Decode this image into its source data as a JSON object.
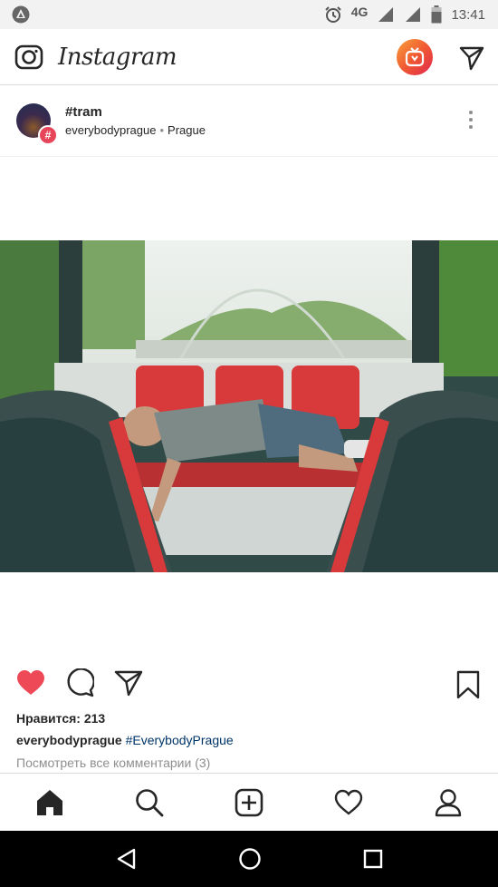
{
  "status_bar": {
    "network": "4G",
    "time": "13:41"
  },
  "header": {
    "app_name": "Instagram"
  },
  "post": {
    "title": "#tram",
    "account": "everybodyprague",
    "location": "Prague",
    "likes_text": "Нравится: 213",
    "caption_user": "everybodyprague",
    "caption_tag": "#EverybodyPrague",
    "view_comments": "Посмотреть все комментарии (3)"
  },
  "colors": {
    "like_red": "#ed4956",
    "igtv_gradient_start": "#f9a03c",
    "igtv_gradient_end": "#e0264e",
    "hashtag_blue": "#003569"
  },
  "bottom_nav": [
    "home-icon",
    "search-icon",
    "add-post-icon",
    "activity-heart-icon",
    "profile-icon"
  ]
}
